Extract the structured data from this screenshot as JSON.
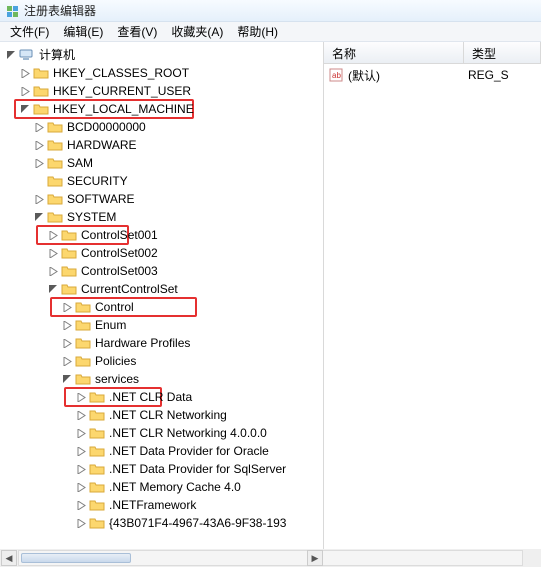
{
  "title": "注册表编辑器",
  "menus": {
    "file": "文件(F)",
    "edit": "编辑(E)",
    "view": "查看(V)",
    "favorites": "收藏夹(A)",
    "help": "帮助(H)"
  },
  "tree": {
    "root": "计算机",
    "hkcr": "HKEY_CLASSES_ROOT",
    "hkcu": "HKEY_CURRENT_USER",
    "hklm": "HKEY_LOCAL_MACHINE",
    "bcd": "BCD00000000",
    "hardware": "HARDWARE",
    "sam": "SAM",
    "security": "SECURITY",
    "software": "SOFTWARE",
    "system": "SYSTEM",
    "cs001": "ControlSet001",
    "cs002": "ControlSet002",
    "cs003": "ControlSet003",
    "ccs": "CurrentControlSet",
    "control": "Control",
    "enum": "Enum",
    "hwprofiles": "Hardware Profiles",
    "policies": "Policies",
    "services": "services",
    "netclrdata": ".NET CLR Data",
    "netclrnet": ".NET CLR Networking",
    "netclrnet4": ".NET CLR Networking 4.0.0.0",
    "netdporacle": ".NET Data Provider for Oracle",
    "netdpsql": ".NET Data Provider for SqlServer",
    "netmemcache": ".NET Memory Cache 4.0",
    "netframework": ".NETFramework",
    "guidkey": "{43B071F4-4967-43A6-9F38-193"
  },
  "list": {
    "header_name": "名称",
    "header_type": "类型",
    "default_name": "(默认)",
    "default_type": "REG_S"
  }
}
